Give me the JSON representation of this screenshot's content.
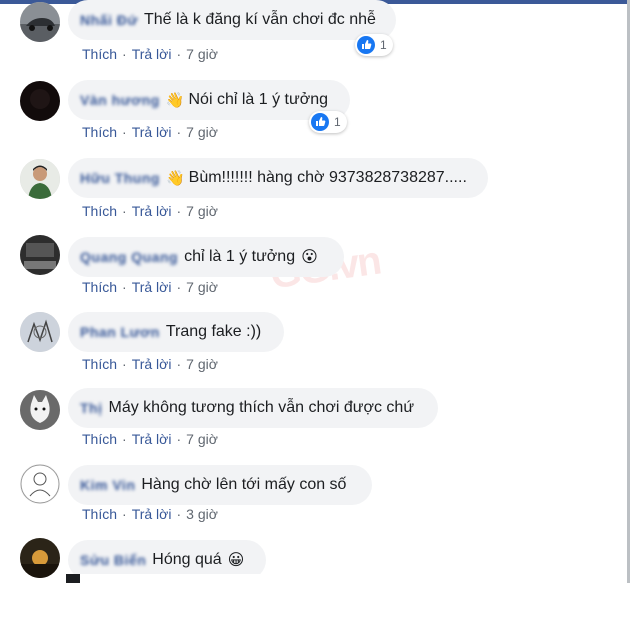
{
  "actions": {
    "like": "Thích",
    "reply": "Trả lời",
    "sep": "·"
  },
  "colors": {
    "link": "#385898",
    "bubble": "#f2f3f5",
    "like_blue": "#1877f2"
  },
  "watermark": "GG.vn",
  "comments": [
    {
      "name": "Nhấi Đứ",
      "text": "Thế là k đăng kí vẫn chơi đc nhễ",
      "time": "7 giờ",
      "reaction_count": "1",
      "avatar": "car-photo"
    },
    {
      "name": "Vàn hương",
      "text": "Nói chỉ là 1 ý tưởng",
      "time": "7 giờ",
      "reaction_count": "1",
      "avatar": "dark-photo",
      "wave": "👋"
    },
    {
      "name": "Hữu Thung",
      "text": "Bùm!!!!!!! hàng chờ 9373828738287.....",
      "time": "7 giờ",
      "avatar": "man-photo",
      "wave": "👋"
    },
    {
      "name": "Quang Quang",
      "text": "chỉ là 1 ý tưởng",
      "time": "7 giờ",
      "avatar": "dark-room-photo",
      "emoji": "😮"
    },
    {
      "name": "Phan Lươn",
      "text": "Trang fake :))",
      "time": "7 giờ",
      "avatar": "sketch-photo"
    },
    {
      "name": "Thị",
      "text": "Máy không tương thích vẫn chơi được chứ",
      "time": "7 giờ",
      "avatar": "cat-drawing"
    },
    {
      "name": "Kim Vin",
      "text": "Hàng chờ lên tới mấy con số",
      "time": "3 giờ",
      "avatar": "line-drawing"
    },
    {
      "name": "Sửu Biển",
      "text": "Hóng quá",
      "time": "",
      "avatar": "sunset-photo",
      "emoji": "😀"
    }
  ]
}
